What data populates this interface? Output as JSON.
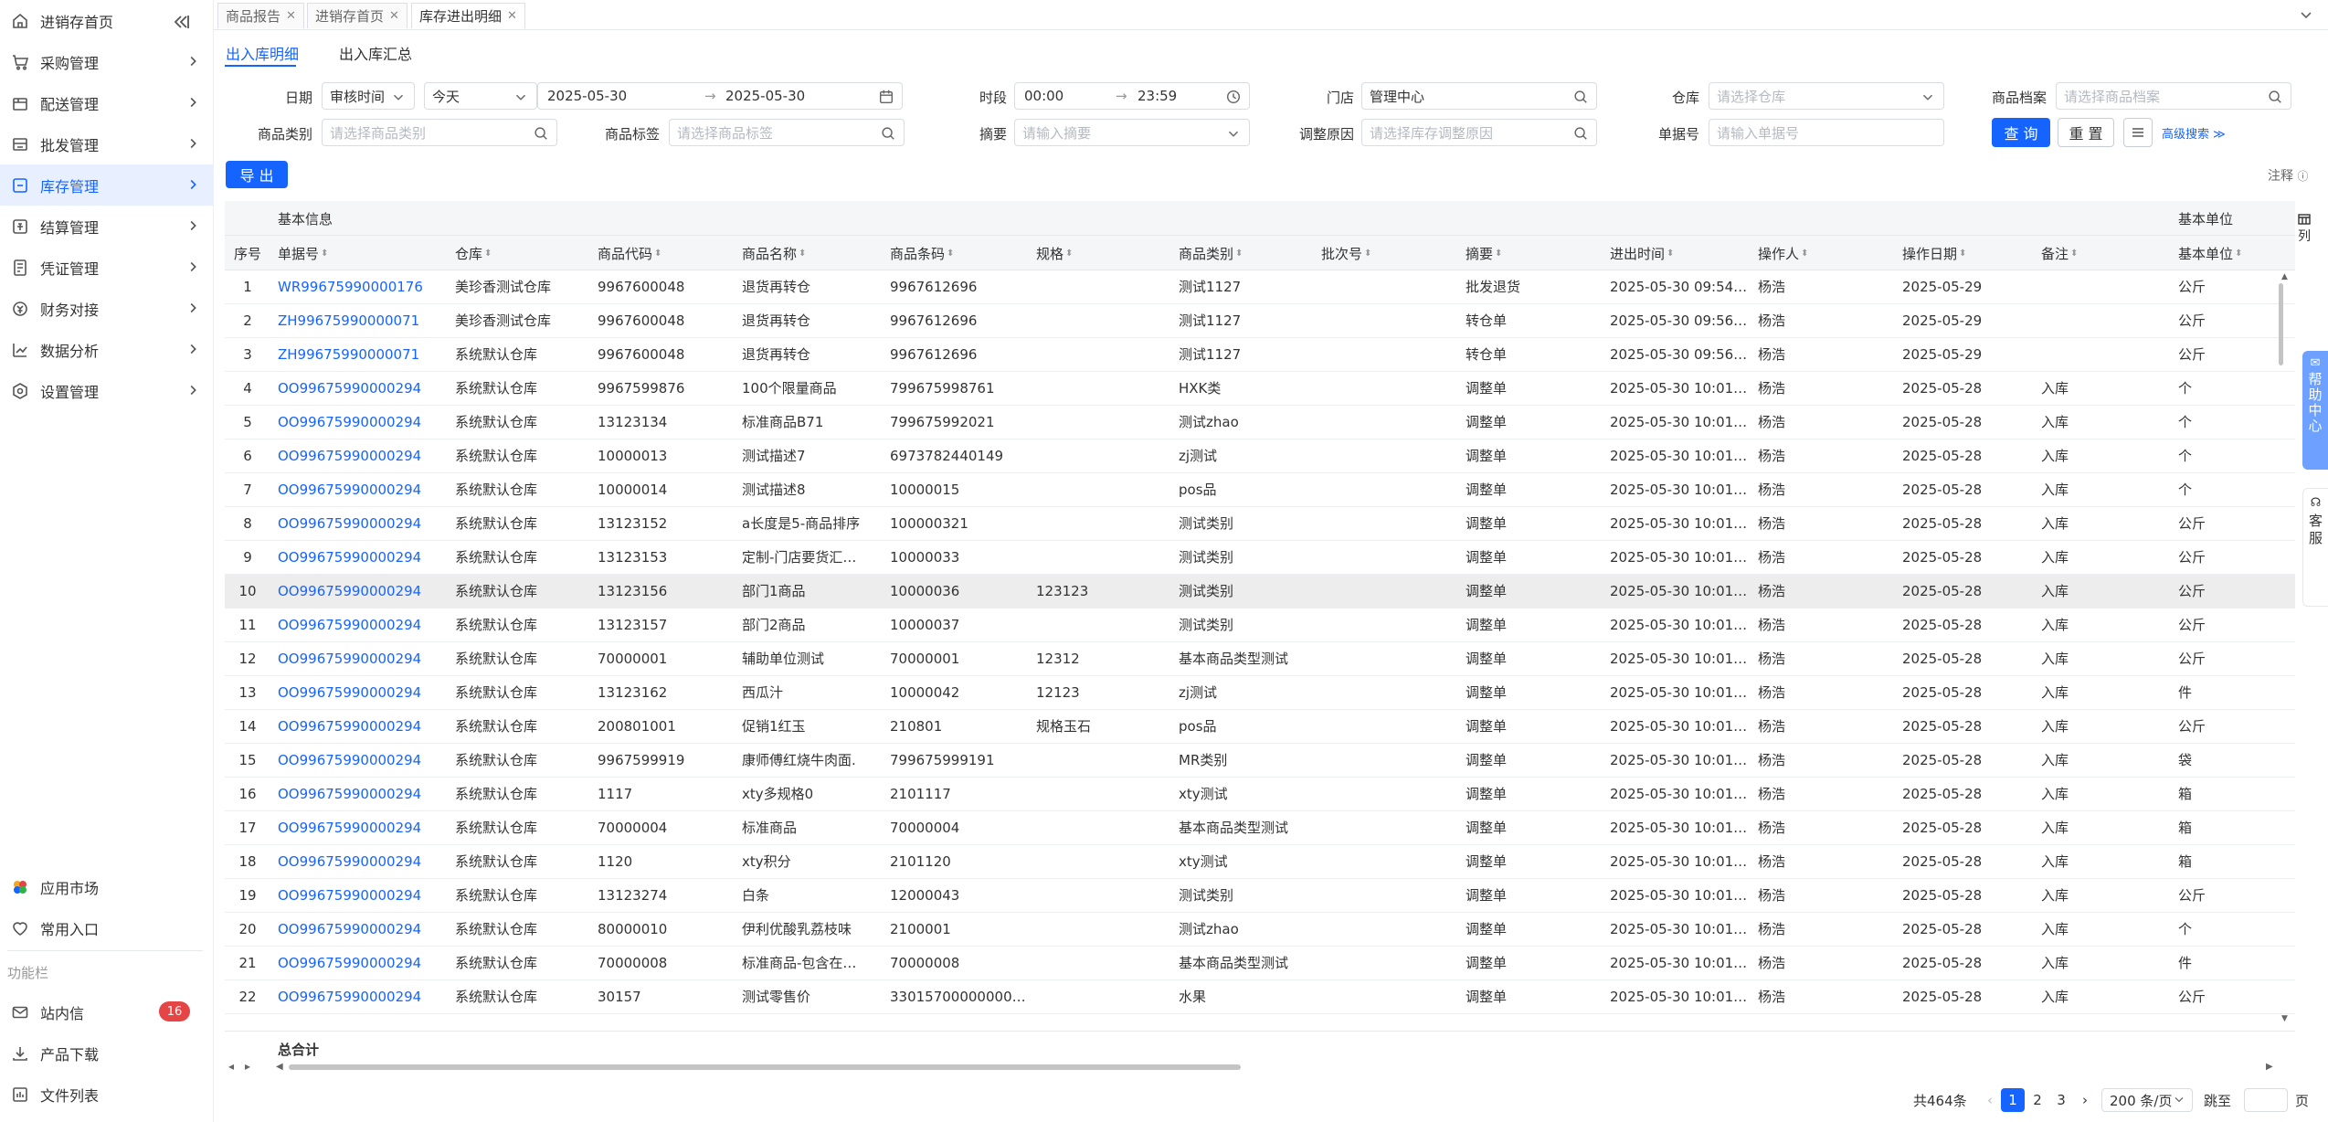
{
  "sidebar": {
    "items": [
      {
        "label": "进销存首页",
        "icon": "home-icon"
      },
      {
        "label": "采购管理",
        "icon": "cart-icon"
      },
      {
        "label": "配送管理",
        "icon": "delivery-box-icon"
      },
      {
        "label": "批发管理",
        "icon": "wholesale-icon"
      },
      {
        "label": "库存管理",
        "icon": "inventory-icon"
      },
      {
        "label": "结算管理",
        "icon": "settlement-icon"
      },
      {
        "label": "凭证管理",
        "icon": "voucher-icon"
      },
      {
        "label": "财务对接",
        "icon": "finance-icon"
      },
      {
        "label": "数据分析",
        "icon": "chart-icon"
      },
      {
        "label": "设置管理",
        "icon": "settings-icon"
      }
    ],
    "active": "库存管理",
    "bottom": {
      "app_market": "应用市场",
      "common_entry": "常用入口",
      "section_label": "功能栏",
      "inbox": "站内信",
      "inbox_badge": "16",
      "download": "产品下载",
      "files": "文件列表"
    }
  },
  "tabs": [
    {
      "label": "商品报告"
    },
    {
      "label": "进销存首页"
    },
    {
      "label": "库存进出明细"
    }
  ],
  "subtabs": {
    "detail": "出入库明细",
    "summary": "出入库汇总"
  },
  "filters": {
    "date_label": "日期",
    "date_type": "审核时间",
    "date_preset": "今天",
    "date_start": "2025-05-30",
    "date_end": "2025-05-30",
    "period_label": "时段",
    "time_start": "00:00",
    "time_end": "23:59",
    "store_label": "门店",
    "store_value": "管理中心",
    "warehouse_label": "仓库",
    "warehouse_ph": "请选择仓库",
    "product_label": "商品档案",
    "product_ph": "请选择商品档案",
    "category_label": "商品类别",
    "category_ph": "请选择商品类别",
    "tag_label": "商品标签",
    "tag_ph": "请选择商品标签",
    "summary_label": "摘要",
    "summary_ph": "请输入摘要",
    "reason_label": "调整原因",
    "reason_ph": "请选择库存调整原因",
    "docno_label": "单据号",
    "docno_ph": "请输入单据号",
    "query": "查 询",
    "reset": "重 置",
    "advanced": "高级搜索",
    "export": "导 出",
    "note": "注释"
  },
  "table": {
    "group_left": "基本信息",
    "group_right": "基本单位",
    "columns": [
      "序号",
      "单据号",
      "仓库",
      "商品代码",
      "商品名称",
      "商品条码",
      "规格",
      "商品类别",
      "批次号",
      "摘要",
      "进出时间",
      "操作人",
      "操作日期",
      "备注",
      "基本单位"
    ],
    "sortable": [
      false,
      true,
      true,
      true,
      true,
      true,
      true,
      true,
      true,
      true,
      true,
      true,
      true,
      true,
      true
    ],
    "rows": [
      [
        "1",
        "WR99675990000176",
        "美珍香测试仓库",
        "9967600048",
        "退货再转仓",
        "9967612696",
        "",
        "测试1127",
        "",
        "批发退货",
        "2025-05-30 09:54:…",
        "杨浩",
        "2025-05-29",
        "",
        "公斤"
      ],
      [
        "2",
        "ZH99675990000071",
        "美珍香测试仓库",
        "9967600048",
        "退货再转仓",
        "9967612696",
        "",
        "测试1127",
        "",
        "转仓单",
        "2025-05-30 09:56:…",
        "杨浩",
        "2025-05-29",
        "",
        "公斤"
      ],
      [
        "3",
        "ZH99675990000071",
        "系统默认仓库",
        "9967600048",
        "退货再转仓",
        "9967612696",
        "",
        "测试1127",
        "",
        "转仓单",
        "2025-05-30 09:56:…",
        "杨浩",
        "2025-05-29",
        "",
        "公斤"
      ],
      [
        "4",
        "OO99675990000294",
        "系统默认仓库",
        "9967599876",
        "100个限量商品",
        "799675998761",
        "",
        "HXK类",
        "",
        "调整单",
        "2025-05-30 10:01:…",
        "杨浩",
        "2025-05-28",
        "入库",
        "个"
      ],
      [
        "5",
        "OO99675990000294",
        "系统默认仓库",
        "13123134",
        "标准商品B71",
        "799675992021",
        "",
        "测试zhao",
        "",
        "调整单",
        "2025-05-30 10:01:…",
        "杨浩",
        "2025-05-28",
        "入库",
        "个"
      ],
      [
        "6",
        "OO99675990000294",
        "系统默认仓库",
        "10000013",
        "测试描述7",
        "6973782440149",
        "",
        "zj测试",
        "",
        "调整单",
        "2025-05-30 10:01:…",
        "杨浩",
        "2025-05-28",
        "入库",
        "个"
      ],
      [
        "7",
        "OO99675990000294",
        "系统默认仓库",
        "10000014",
        "测试描述8",
        "10000015",
        "",
        "pos品",
        "",
        "调整单",
        "2025-05-30 10:01:…",
        "杨浩",
        "2025-05-28",
        "入库",
        "个"
      ],
      [
        "8",
        "OO99675990000294",
        "系统默认仓库",
        "13123152",
        "a长度是5-商品排序",
        "100000321",
        "",
        "测试类别",
        "",
        "调整单",
        "2025-05-30 10:01:…",
        "杨浩",
        "2025-05-28",
        "入库",
        "公斤"
      ],
      [
        "9",
        "OO99675990000294",
        "系统默认仓库",
        "13123153",
        "定制-门店要货汇…",
        "10000033",
        "",
        "测试类别",
        "",
        "调整单",
        "2025-05-30 10:01:…",
        "杨浩",
        "2025-05-28",
        "入库",
        "公斤"
      ],
      [
        "10",
        "OO99675990000294",
        "系统默认仓库",
        "13123156",
        "部门1商品",
        "10000036",
        "123123",
        "测试类别",
        "",
        "调整单",
        "2025-05-30 10:01:…",
        "杨浩",
        "2025-05-28",
        "入库",
        "公斤"
      ],
      [
        "11",
        "OO99675990000294",
        "系统默认仓库",
        "13123157",
        "部门2商品",
        "10000037",
        "",
        "测试类别",
        "",
        "调整单",
        "2025-05-30 10:01:…",
        "杨浩",
        "2025-05-28",
        "入库",
        "公斤"
      ],
      [
        "12",
        "OO99675990000294",
        "系统默认仓库",
        "70000001",
        "辅助单位测试",
        "70000001",
        "12312",
        "基本商品类型测试",
        "",
        "调整单",
        "2025-05-30 10:01:…",
        "杨浩",
        "2025-05-28",
        "入库",
        "公斤"
      ],
      [
        "13",
        "OO99675990000294",
        "系统默认仓库",
        "13123162",
        "西瓜汁",
        "10000042",
        "12123",
        "zj测试",
        "",
        "调整单",
        "2025-05-30 10:01:…",
        "杨浩",
        "2025-05-28",
        "入库",
        "件"
      ],
      [
        "14",
        "OO99675990000294",
        "系统默认仓库",
        "200801001",
        "促销1红玉",
        "210801",
        "规格玉石",
        "pos品",
        "",
        "调整单",
        "2025-05-30 10:01:…",
        "杨浩",
        "2025-05-28",
        "入库",
        "公斤"
      ],
      [
        "15",
        "OO99675990000294",
        "系统默认仓库",
        "9967599919",
        "康师傅红烧牛肉面.",
        "799675999191",
        "",
        "MR类别",
        "",
        "调整单",
        "2025-05-30 10:01:…",
        "杨浩",
        "2025-05-28",
        "入库",
        "袋"
      ],
      [
        "16",
        "OO99675990000294",
        "系统默认仓库",
        "1117",
        "xty多规格0",
        "2101117",
        "",
        "xty测试",
        "",
        "调整单",
        "2025-05-30 10:01:…",
        "杨浩",
        "2025-05-28",
        "入库",
        "箱"
      ],
      [
        "17",
        "OO99675990000294",
        "系统默认仓库",
        "70000004",
        "标准商品",
        "70000004",
        "",
        "基本商品类型测试",
        "",
        "调整单",
        "2025-05-30 10:01:…",
        "杨浩",
        "2025-05-28",
        "入库",
        "箱"
      ],
      [
        "18",
        "OO99675990000294",
        "系统默认仓库",
        "1120",
        "xty积分",
        "2101120",
        "",
        "xty测试",
        "",
        "调整单",
        "2025-05-30 10:01:…",
        "杨浩",
        "2025-05-28",
        "入库",
        "箱"
      ],
      [
        "19",
        "OO99675990000294",
        "系统默认仓库",
        "13123274",
        "白条",
        "12000043",
        "",
        "测试类别",
        "",
        "调整单",
        "2025-05-30 10:01:…",
        "杨浩",
        "2025-05-28",
        "入库",
        "公斤"
      ],
      [
        "20",
        "OO99675990000294",
        "系统默认仓库",
        "80000010",
        "伊利优酸乳荔枝味",
        "2100001",
        "",
        "测试zhao",
        "",
        "调整单",
        "2025-05-30 10:01:…",
        "杨浩",
        "2025-05-28",
        "入库",
        "个"
      ],
      [
        "21",
        "OO99675990000294",
        "系统默认仓库",
        "70000008",
        "标准商品-包含在…",
        "70000008",
        "",
        "基本商品类型测试",
        "",
        "调整单",
        "2025-05-30 10:01:…",
        "杨浩",
        "2025-05-28",
        "入库",
        "件"
      ],
      [
        "22",
        "OO99675990000294",
        "系统默认仓库",
        "30157",
        "测试零售价",
        "33015700000000…",
        "",
        "水果",
        "",
        "调整单",
        "2025-05-30 10:01:…",
        "杨浩",
        "2025-05-28",
        "入库",
        "公斤"
      ]
    ],
    "highlighted_row": 10,
    "total_label": "总合计"
  },
  "pagination": {
    "total": "共464条",
    "pages": [
      "1",
      "2",
      "3"
    ],
    "current": "1",
    "page_size": "200 条/页",
    "jump_label": "跳至",
    "page_suffix": "页"
  },
  "float": {
    "help": "帮助中心",
    "service": "客服",
    "columns": "列"
  },
  "colors": {
    "primary": "#1664ff",
    "active_bg": "#e8f0ff",
    "badge": "#e64545"
  }
}
